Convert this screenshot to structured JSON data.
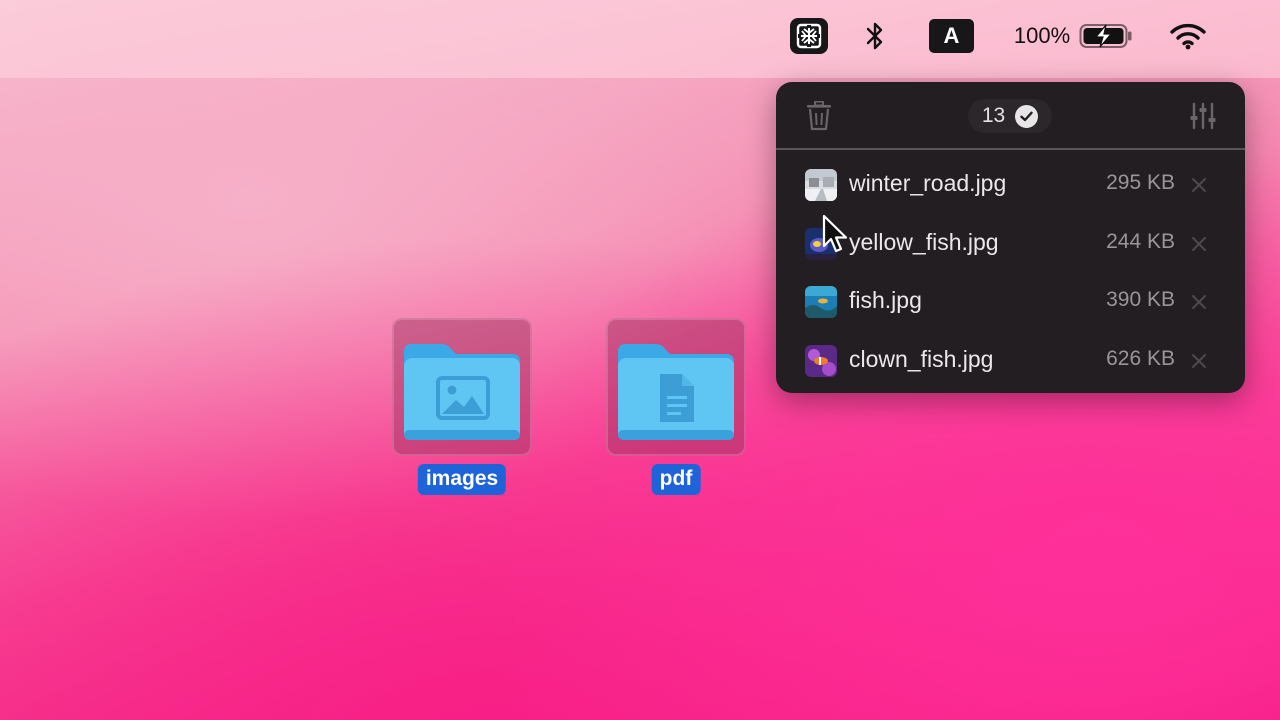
{
  "menubar": {
    "app_icon": "app-grid-icon",
    "bluetooth_icon": "bluetooth-icon",
    "input_source_label": "A",
    "battery_percent": "100%",
    "battery_icon": "battery-charging-icon",
    "wifi_icon": "wifi-icon"
  },
  "panel": {
    "trash_icon": "trash-icon",
    "count": "13",
    "check_icon": "check-icon",
    "settings_icon": "sliders-icon",
    "files": [
      {
        "name": "winter_road.jpg",
        "size": "295 KB"
      },
      {
        "name": "yellow_fish.jpg",
        "size": "244 KB"
      },
      {
        "name": "fish.jpg",
        "size": "390 KB"
      },
      {
        "name": "clown_fish.jpg",
        "size": "626 KB"
      }
    ]
  },
  "desktop": {
    "folders": [
      {
        "label": "images",
        "icon": "image-folder-icon"
      },
      {
        "label": "pdf",
        "icon": "document-folder-icon"
      }
    ]
  },
  "colors": {
    "panel_bg": "#231e22",
    "selection_label": "#1f63d8",
    "folder_blue": "#5fc6f4"
  }
}
